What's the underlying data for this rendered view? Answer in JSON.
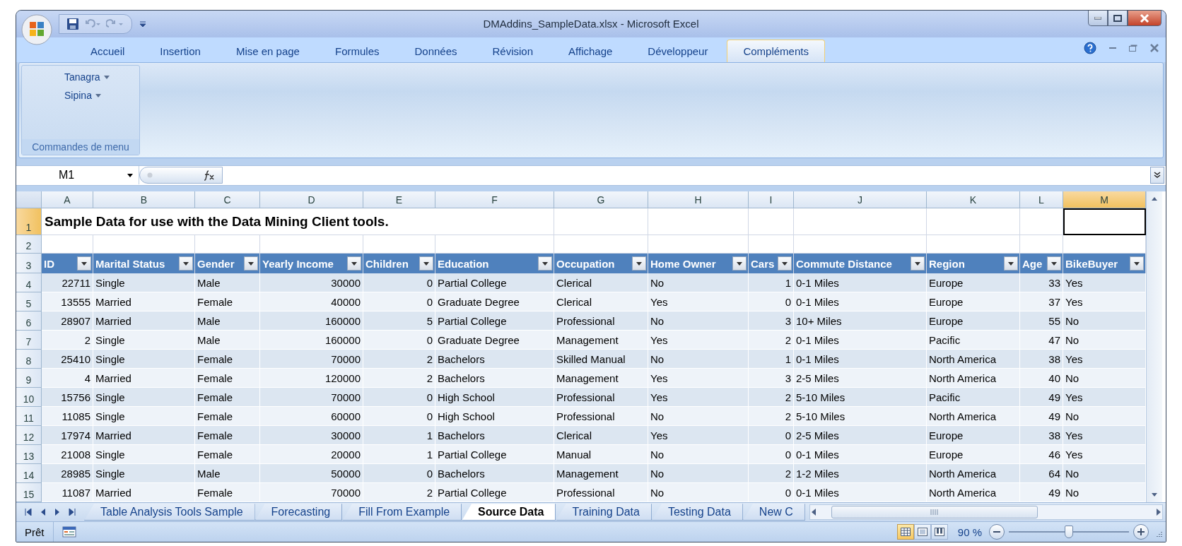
{
  "window": {
    "title": "DMAddins_SampleData.xlsx - Microsoft Excel"
  },
  "ribbon": {
    "tabs": [
      {
        "label": "Accueil",
        "selected": false
      },
      {
        "label": "Insertion",
        "selected": false
      },
      {
        "label": "Mise en page",
        "selected": false
      },
      {
        "label": "Formules",
        "selected": false
      },
      {
        "label": "Données",
        "selected": false
      },
      {
        "label": "Révision",
        "selected": false
      },
      {
        "label": "Affichage",
        "selected": false
      },
      {
        "label": "Développeur",
        "selected": false
      },
      {
        "label": "Compléments",
        "selected": true
      }
    ],
    "group": {
      "label": "Commandes de menu",
      "buttons": [
        "Tanagra",
        "Sipina"
      ]
    }
  },
  "formula_bar": {
    "name_box": "M1"
  },
  "columns": [
    {
      "letter": "A",
      "kind": "number",
      "selected": false
    },
    {
      "letter": "B",
      "kind": "text",
      "selected": false
    },
    {
      "letter": "C",
      "kind": "text",
      "selected": false
    },
    {
      "letter": "D",
      "kind": "number",
      "selected": false
    },
    {
      "letter": "E",
      "kind": "number",
      "selected": false
    },
    {
      "letter": "F",
      "kind": "text",
      "selected": false
    },
    {
      "letter": "G",
      "kind": "text",
      "selected": false
    },
    {
      "letter": "H",
      "kind": "text",
      "selected": false
    },
    {
      "letter": "I",
      "kind": "number",
      "selected": false
    },
    {
      "letter": "J",
      "kind": "text",
      "selected": false
    },
    {
      "letter": "K",
      "kind": "text",
      "selected": false
    },
    {
      "letter": "L",
      "kind": "number",
      "selected": false
    },
    {
      "letter": "M",
      "kind": "text",
      "selected": true
    }
  ],
  "rows": [
    {
      "number": "1",
      "selected": true,
      "kind": "title",
      "title": "Sample Data for use with the Data Mining Client tools."
    },
    {
      "number": "2",
      "selected": false,
      "kind": "blank"
    },
    {
      "number": "3",
      "selected": false,
      "kind": "header",
      "cells": [
        "ID",
        "Marital Status",
        "Gender",
        "Yearly Income",
        "Children",
        "Education",
        "Occupation",
        "Home Owner",
        "Cars",
        "Commute Distance",
        "Region",
        "Age",
        "BikeBuyer"
      ]
    },
    {
      "number": "4",
      "selected": false,
      "kind": "data",
      "cells": [
        "22711",
        "Single",
        "Male",
        "30000",
        "0",
        "Partial College",
        "Clerical",
        "No",
        "1",
        "0-1 Miles",
        "Europe",
        "33",
        "Yes"
      ]
    },
    {
      "number": "5",
      "selected": false,
      "kind": "data",
      "cells": [
        "13555",
        "Married",
        "Female",
        "40000",
        "0",
        "Graduate Degree",
        "Clerical",
        "Yes",
        "0",
        "0-1 Miles",
        "Europe",
        "37",
        "Yes"
      ]
    },
    {
      "number": "6",
      "selected": false,
      "kind": "data",
      "cells": [
        "28907",
        "Married",
        "Male",
        "160000",
        "5",
        "Partial College",
        "Professional",
        "No",
        "3",
        "10+ Miles",
        "Europe",
        "55",
        "No"
      ]
    },
    {
      "number": "7",
      "selected": false,
      "kind": "data",
      "cells": [
        "2",
        "Single",
        "Male",
        "160000",
        "0",
        "Graduate Degree",
        "Management",
        "Yes",
        "2",
        "0-1 Miles",
        "Pacific",
        "47",
        "No"
      ]
    },
    {
      "number": "8",
      "selected": false,
      "kind": "data",
      "cells": [
        "25410",
        "Single",
        "Female",
        "70000",
        "2",
        "Bachelors",
        "Skilled Manual",
        "No",
        "1",
        "0-1 Miles",
        "North America",
        "38",
        "Yes"
      ]
    },
    {
      "number": "9",
      "selected": false,
      "kind": "data",
      "cells": [
        "4",
        "Married",
        "Female",
        "120000",
        "2",
        "Bachelors",
        "Management",
        "Yes",
        "3",
        "2-5 Miles",
        "North America",
        "40",
        "No"
      ]
    },
    {
      "number": "10",
      "selected": false,
      "kind": "data",
      "cells": [
        "15756",
        "Single",
        "Female",
        "70000",
        "0",
        "High School",
        "Professional",
        "Yes",
        "2",
        "5-10 Miles",
        "Pacific",
        "49",
        "Yes"
      ]
    },
    {
      "number": "11",
      "selected": false,
      "kind": "data",
      "cells": [
        "11085",
        "Single",
        "Female",
        "60000",
        "0",
        "High School",
        "Professional",
        "No",
        "2",
        "5-10 Miles",
        "North America",
        "49",
        "No"
      ]
    },
    {
      "number": "12",
      "selected": false,
      "kind": "data",
      "cells": [
        "17974",
        "Married",
        "Female",
        "30000",
        "1",
        "Bachelors",
        "Clerical",
        "Yes",
        "0",
        "2-5 Miles",
        "Europe",
        "38",
        "Yes"
      ]
    },
    {
      "number": "13",
      "selected": false,
      "kind": "data",
      "cells": [
        "21008",
        "Single",
        "Female",
        "20000",
        "1",
        "Partial College",
        "Manual",
        "No",
        "0",
        "0-1 Miles",
        "Europe",
        "46",
        "Yes"
      ]
    },
    {
      "number": "14",
      "selected": false,
      "kind": "data",
      "cells": [
        "28985",
        "Single",
        "Male",
        "50000",
        "0",
        "Bachelors",
        "Management",
        "No",
        "2",
        "1-2 Miles",
        "North America",
        "64",
        "No"
      ]
    },
    {
      "number": "15",
      "selected": false,
      "kind": "data",
      "cells": [
        "11087",
        "Married",
        "Female",
        "70000",
        "2",
        "Partial College",
        "Professional",
        "No",
        "0",
        "0-1 Miles",
        "North America",
        "49",
        "No"
      ]
    }
  ],
  "sheet_tabs": [
    {
      "label": "Table Analysis Tools Sample",
      "selected": false
    },
    {
      "label": "Forecasting",
      "selected": false
    },
    {
      "label": "Fill From Example",
      "selected": false
    },
    {
      "label": "Source Data",
      "selected": true
    },
    {
      "label": "Training Data",
      "selected": false
    },
    {
      "label": "Testing Data",
      "selected": false
    },
    {
      "label": "New C",
      "selected": false
    }
  ],
  "status_bar": {
    "status": "Prêt",
    "views": [
      {
        "kind": "normal",
        "selected": true
      },
      {
        "kind": "layout",
        "selected": false
      },
      {
        "kind": "pagebreak",
        "selected": false
      }
    ],
    "zoom": "90 %",
    "zoom_slider": {
      "level": 0.5
    }
  }
}
